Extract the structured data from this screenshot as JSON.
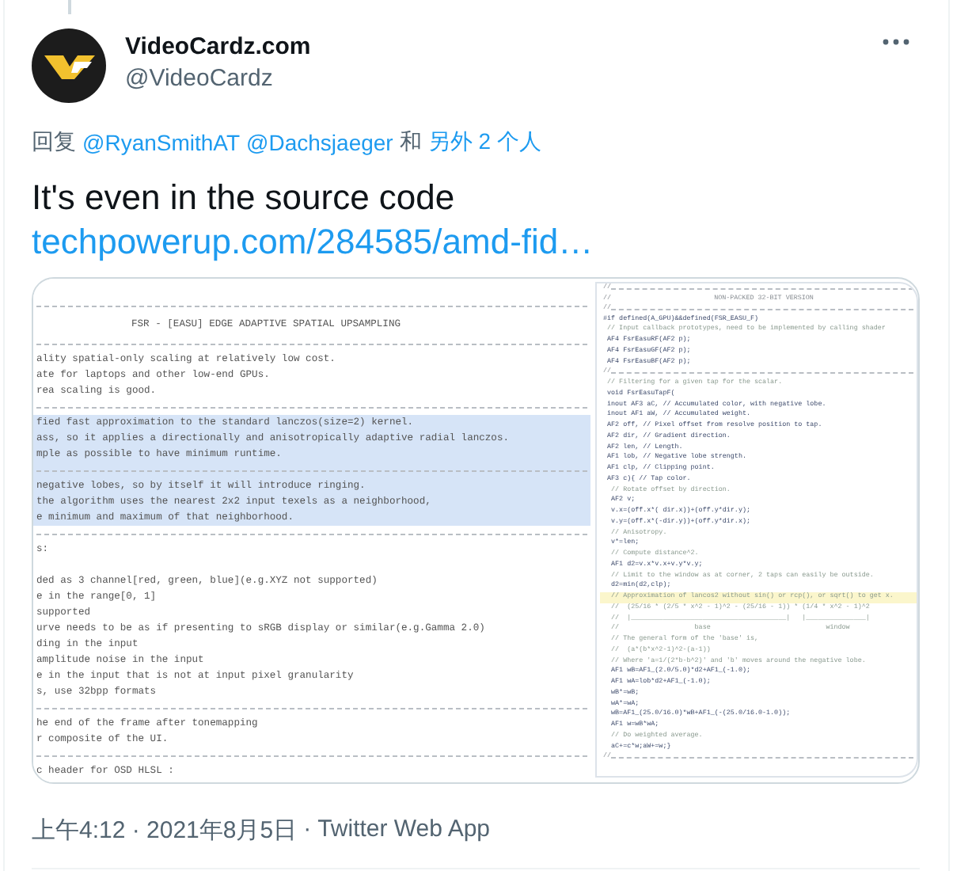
{
  "author": {
    "name": "VideoCardz.com",
    "handle": "@VideoCardz"
  },
  "reply_to": {
    "prefix": "回复",
    "mentions": [
      "@RyanSmithAT",
      "@Dachsjaeger"
    ],
    "conjunction": "和",
    "others": "另外 2 个人"
  },
  "text": "It's even in the source code",
  "link": "techpowerup.com/284585/amd-fid…",
  "image": {
    "left_pane": {
      "rows": [
        {
          "kind": "rule",
          "highlighted": false
        },
        {
          "kind": "title",
          "text": "FSR - [EASU] EDGE ADAPTIVE SPATIAL UPSAMPLING",
          "highlighted": false
        },
        {
          "kind": "rule",
          "highlighted": false
        },
        {
          "kind": "text",
          "text": "ality spatial-only scaling at relatively low cost.",
          "highlighted": false
        },
        {
          "kind": "text",
          "text": "ate for laptops and other low-end GPUs.",
          "highlighted": false
        },
        {
          "kind": "text",
          "text": "rea scaling is good.",
          "highlighted": false
        },
        {
          "kind": "rule",
          "highlighted": false
        },
        {
          "kind": "text",
          "text": "fied fast approximation to the standard lanczos(size=2) kernel.",
          "highlighted": true
        },
        {
          "kind": "text",
          "text": "ass, so it applies a directionally and anisotropically adaptive radial lanczos.",
          "highlighted": true
        },
        {
          "kind": "text",
          "text": "mple as possible to have minimum runtime.",
          "highlighted": true
        },
        {
          "kind": "rule",
          "highlighted": true
        },
        {
          "kind": "text",
          "text": "negative lobes, so by itself it will introduce ringing.",
          "highlighted": true
        },
        {
          "kind": "text",
          "text": "the algorithm uses the nearest 2x2 input texels as a neighborhood,",
          "highlighted": true
        },
        {
          "kind": "text",
          "text": "e minimum and maximum of that neighborhood.",
          "highlighted": true
        },
        {
          "kind": "rule",
          "highlighted": false
        },
        {
          "kind": "text",
          "text": "s:",
          "highlighted": false
        },
        {
          "kind": "blank",
          "highlighted": false
        },
        {
          "kind": "text",
          "text": "ded as 3 channel[red, green, blue](e.g.XYZ not supported)",
          "highlighted": false
        },
        {
          "kind": "text",
          "text": "e in the range[0, 1]",
          "highlighted": false
        },
        {
          "kind": "text",
          "text": "supported",
          "highlighted": false
        },
        {
          "kind": "text",
          "text": "urve needs to be as if presenting to sRGB display or similar(e.g.Gamma 2.0)",
          "highlighted": false
        },
        {
          "kind": "text",
          "text": "ding in the input",
          "highlighted": false
        },
        {
          "kind": "text",
          "text": "amplitude noise in the input",
          "highlighted": false
        },
        {
          "kind": "text",
          "text": "e in the input that is not at input pixel granularity",
          "highlighted": false
        },
        {
          "kind": "text",
          "text": "s, use 32bpp formats",
          "highlighted": false
        },
        {
          "kind": "rule",
          "highlighted": false
        },
        {
          "kind": "text",
          "text": "he end of the frame after tonemapping",
          "highlighted": false
        },
        {
          "kind": "text",
          "text": "r composite of the UI.",
          "highlighted": false
        },
        {
          "kind": "rule",
          "highlighted": false
        },
        {
          "kind": "text",
          "text": "c header for OSD HLSL :",
          "highlighted": false
        }
      ]
    },
    "right_pane": {
      "rows": [
        {
          "kind": "rule",
          "text": "//",
          "highlighted": false
        },
        {
          "kind": "title",
          "prefix": "//",
          "text": "NON-PACKED 32-BIT VERSION",
          "highlighted": false
        },
        {
          "kind": "rule",
          "text": "//",
          "highlighted": false
        },
        {
          "kind": "code",
          "text": "#if defined(A_GPU)&&defined(FSR_EASU_F)",
          "highlighted": false
        },
        {
          "kind": "comment",
          "text": " // Input callback prototypes, need to be implemented by calling shader",
          "highlighted": false
        },
        {
          "kind": "code",
          "text": " AF4 FsrEasuRF(AF2 p);",
          "highlighted": false
        },
        {
          "kind": "code",
          "text": " AF4 FsrEasuGF(AF2 p);",
          "highlighted": false
        },
        {
          "kind": "code",
          "text": " AF4 FsrEasuBF(AF2 p);",
          "highlighted": false
        },
        {
          "kind": "rule",
          "text": "//",
          "highlighted": false
        },
        {
          "kind": "comment",
          "text": " // Filtering for a given tap for the scalar.",
          "highlighted": false
        },
        {
          "kind": "code",
          "text": " void FsrEasuTapF(",
          "highlighted": false
        },
        {
          "kind": "code",
          "text": " inout AF3 aC, // Accumulated color, with negative lobe.",
          "highlighted": false
        },
        {
          "kind": "code",
          "text": " inout AF1 aW, // Accumulated weight.",
          "highlighted": false
        },
        {
          "kind": "code",
          "text": " AF2 off, // Pixel offset from resolve position to tap.",
          "highlighted": false
        },
        {
          "kind": "code",
          "text": " AF2 dir, // Gradient direction.",
          "highlighted": false
        },
        {
          "kind": "code",
          "text": " AF2 len, // Length.",
          "highlighted": false
        },
        {
          "kind": "code",
          "text": " AF1 lob, // Negative lobe strength.",
          "highlighted": false
        },
        {
          "kind": "code",
          "text": " AF1 clp, // Clipping point.",
          "highlighted": false
        },
        {
          "kind": "code",
          "text": " AF3 c){ // Tap color.",
          "highlighted": false
        },
        {
          "kind": "comment",
          "text": "  // Rotate offset by direction.",
          "highlighted": false
        },
        {
          "kind": "code",
          "text": "  AF2 v;",
          "highlighted": false
        },
        {
          "kind": "code",
          "text": "  v.x=(off.x*( dir.x))+(off.y*dir.y);",
          "highlighted": false
        },
        {
          "kind": "code",
          "text": "  v.y=(off.x*(-dir.y))+(off.y*dir.x);",
          "highlighted": false
        },
        {
          "kind": "comment",
          "text": "  // Anisotropy.",
          "highlighted": false
        },
        {
          "kind": "code",
          "text": "  v*=len;",
          "highlighted": false
        },
        {
          "kind": "comment",
          "text": "  // Compute distance^2.",
          "highlighted": false
        },
        {
          "kind": "code",
          "text": "  AF1 d2=v.x*v.x+v.y*v.y;",
          "highlighted": false
        },
        {
          "kind": "comment",
          "text": "  // Limit to the window as at corner, 2 taps can easily be outside.",
          "highlighted": false
        },
        {
          "kind": "code",
          "text": "  d2=min(d2,clp);",
          "highlighted": false
        },
        {
          "kind": "comment",
          "text": "  // Approximation of lancos2 without sin() or rcp(), or sqrt() to get x.",
          "highlighted": true
        },
        {
          "kind": "comment",
          "text": "  //  (25/16 * (2/5 * x^2 - 1)^2 - (25/16 - 1)) * (1/4 * x^2 - 1)^2",
          "highlighted": false
        },
        {
          "kind": "comment",
          "text": "  //  |_______________________________________|   |_______________|",
          "highlighted": false
        },
        {
          "kind": "comment",
          "text": "  //                   base                             window",
          "highlighted": false
        },
        {
          "kind": "comment",
          "text": "  // The general form of the 'base' is,",
          "highlighted": false
        },
        {
          "kind": "comment",
          "text": "  //  (a*(b*x^2-1)^2-(a-1))",
          "highlighted": false
        },
        {
          "kind": "comment",
          "text": "  // Where 'a=1/(2*b-b^2)' and 'b' moves around the negative lobe.",
          "highlighted": false
        },
        {
          "kind": "code",
          "text": "  AF1 wB=AF1_(2.0/5.0)*d2+AF1_(-1.0);",
          "highlighted": false
        },
        {
          "kind": "code",
          "text": "  AF1 wA=lob*d2+AF1_(-1.0);",
          "highlighted": false
        },
        {
          "kind": "code",
          "text": "  wB*=wB;",
          "highlighted": false
        },
        {
          "kind": "code",
          "text": "  wA*=wA;",
          "highlighted": false
        },
        {
          "kind": "code",
          "text": "  wB=AF1_(25.0/16.0)*wB+AF1_(-(25.0/16.0-1.0));",
          "highlighted": false
        },
        {
          "kind": "code",
          "text": "  AF1 w=wB*wA;",
          "highlighted": false
        },
        {
          "kind": "comment",
          "text": "  // Do weighted average.",
          "highlighted": false
        },
        {
          "kind": "code",
          "text": "  aC+=c*w;aW+=w;}",
          "highlighted": false
        },
        {
          "kind": "rule",
          "text": "//",
          "highlighted": false
        }
      ]
    }
  },
  "footer": {
    "timestamp": "上午4:12 · 2021年8月5日",
    "separator": "·",
    "source": "Twitter Web App"
  }
}
